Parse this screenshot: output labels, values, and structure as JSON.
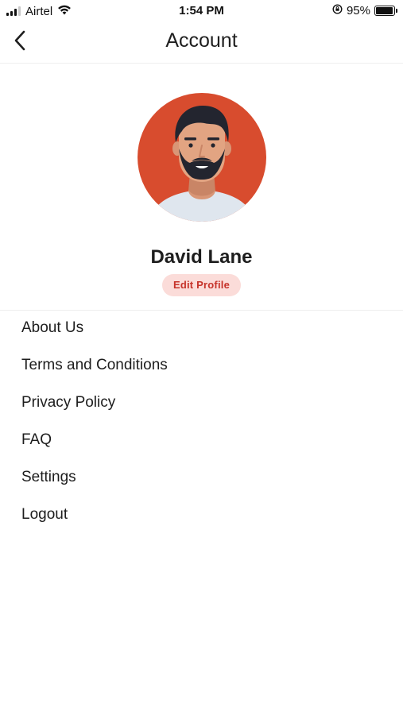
{
  "status_bar": {
    "carrier": "Airtel",
    "time": "1:54 PM",
    "battery_percent": "95%",
    "battery_level": 0.95
  },
  "nav": {
    "title": "Account",
    "back_icon": "chevron-left-icon"
  },
  "profile": {
    "name": "David Lane",
    "edit_label": "Edit Profile",
    "avatar_bg": "#d84c2e"
  },
  "menu": {
    "items": [
      {
        "label": "About Us"
      },
      {
        "label": "Terms and Conditions"
      },
      {
        "label": "Privacy Policy"
      },
      {
        "label": "FAQ"
      },
      {
        "label": "Settings"
      },
      {
        "label": "Logout"
      }
    ]
  },
  "colors": {
    "accent": "#c6332a",
    "accent_bg": "#fbdcd9"
  }
}
